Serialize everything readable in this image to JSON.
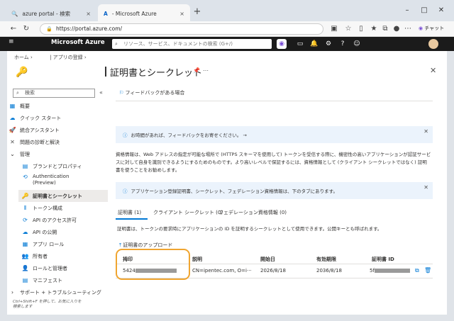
{
  "browser": {
    "tabs": [
      {
        "label": "azure portal - 検索",
        "close": "×"
      },
      {
        "label": "- Microsoft Azure",
        "close": "×"
      }
    ],
    "new_tab": "+",
    "url": "https://portal.azure.com/",
    "chat_label": "チャット",
    "window_controls": {
      "minimize": "–",
      "maximize": "□",
      "close": "✕"
    }
  },
  "azure": {
    "brand": "Microsoft Azure",
    "search_placeholder": "リソース、サービス、ドキュメントの検索 (G+/)"
  },
  "breadcrumb": {
    "home": "ホーム",
    "sep1": "›",
    "app_reg": "| アプリの登録",
    "sep2": "›"
  },
  "page": {
    "title": "証明書とシークレット"
  },
  "sidebar": {
    "search_placeholder": "検索",
    "items": [
      {
        "label": "概要"
      },
      {
        "label": "クイック スタート"
      },
      {
        "label": "統合アシスタント"
      },
      {
        "label": "問題の診断と解決"
      },
      {
        "label": "管理"
      },
      {
        "label": "ブランドとプロパティ"
      },
      {
        "label": "Authentication"
      },
      {
        "label": "(Preview)"
      },
      {
        "label": "証明書とシークレット"
      },
      {
        "label": "トークン構成"
      },
      {
        "label": "API のアクセス許可"
      },
      {
        "label": "API の公開"
      },
      {
        "label": "アプリ ロール"
      },
      {
        "label": "所有者"
      },
      {
        "label": "ロールと管理者"
      },
      {
        "label": "マニフェスト"
      },
      {
        "label": "サポート + トラブルシューティング"
      }
    ],
    "note": "Ctrl+Shift+F を押して、お気に入りを検索します"
  },
  "content": {
    "feedback": "フィードバックがある場合",
    "banner1": "お時間があれば、フィードバックをお寄せください。 →",
    "description": "資格情報は、Web アドレスの指定が可能な場所で (HTTPS スキーマを使用して) トークンを受信する際に、機密性の高いアプリケーションが認証サービスに対して自身を識別できるようにするためのものです。より高いレベルで保証するには、資格情報として (クライアント シークレットではなく) 証明書を使うことをお勧めします。",
    "banner2": "アプリケーション登録証明書、シークレット、フェデレーション資格情報は、下のタブにあります。",
    "tabs": [
      "証明書 (1)",
      "クライアント シークレット (0)",
      "フェデレーション資格情報 (0)"
    ],
    "cert_desc": "証明書は、トークンの要求時にアプリケーションの ID を証明するシークレットとして使用できます。公開キーとも呼ばれます。",
    "upload": "証明書のアップロード",
    "table": {
      "headers": [
        "拇印",
        "説明",
        "開始日",
        "有効期限",
        "証明書 ID"
      ],
      "row": {
        "thumb": "5424",
        "desc": "CN=ipentec.com, O=i···",
        "start": "2026/8/18",
        "expiry": "2036/8/18",
        "id": "5f"
      }
    }
  }
}
